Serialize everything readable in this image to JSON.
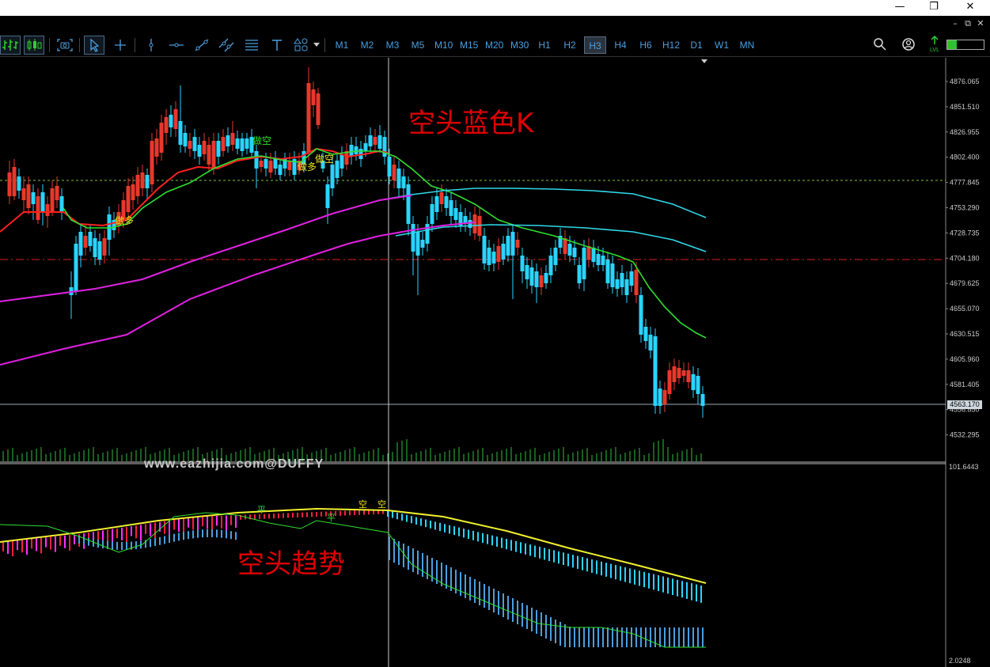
{
  "window": {
    "minimize": "—",
    "restore": "❐",
    "close": "✕"
  },
  "mdi": {
    "minimize": "–",
    "restore": "⧉",
    "close": "✕"
  },
  "toolbar": {
    "icons": [
      "chart-bars-icon",
      "chart-candles-icon",
      "screenshot-icon",
      "cursor-icon",
      "crosshair-icon",
      "vertical-line-icon",
      "horizontal-line-icon",
      "trend-line-icon",
      "channel-icon",
      "fibonacci-icon",
      "text-icon",
      "shapes-icon"
    ],
    "timeframes": [
      "M1",
      "M2",
      "M3",
      "M5",
      "M10",
      "M15",
      "M20",
      "M30",
      "H1",
      "H2",
      "H3",
      "H4",
      "H6",
      "H12",
      "D1",
      "W1",
      "MN"
    ],
    "active_timeframe": "H3",
    "right_icons": [
      "search-icon",
      "account-icon",
      "level-icon",
      "battery-icon"
    ],
    "level_label": "LVL"
  },
  "price_axis": {
    "labels": [
      "4876.065",
      "4851.510",
      "4826.955",
      "4802.400",
      "4777.845",
      "4753.290",
      "4728.735",
      "4704.180",
      "4679.625",
      "4655.070",
      "4630.515",
      "4605.960",
      "4581.405",
      "4556.850",
      "4532.295"
    ],
    "current_price": "4563.170"
  },
  "indicator_axis": {
    "top": "101.6443",
    "bottom": "2.0248"
  },
  "annotations": {
    "main_title": "空头蓝色K",
    "sub_title": "空头趋势",
    "watermark": "www.eazhijia.com@DUFFY",
    "signals_main": [
      "做空",
      "做多",
      "做空",
      "做多"
    ],
    "signals_sub": [
      "平",
      "空",
      "空",
      "平"
    ]
  },
  "colors": {
    "bull_candle": "#e8382c",
    "bear_candle": "#2ad4ff",
    "ma_fast": "#ff2020",
    "ma_green": "#30e030",
    "ma_magenta": "#e020e0",
    "ma_cyan": "#30d8e8",
    "signal_red_dash": "#e02020",
    "signal_green_dash": "#80c040",
    "text_red": "#e00000"
  }
}
